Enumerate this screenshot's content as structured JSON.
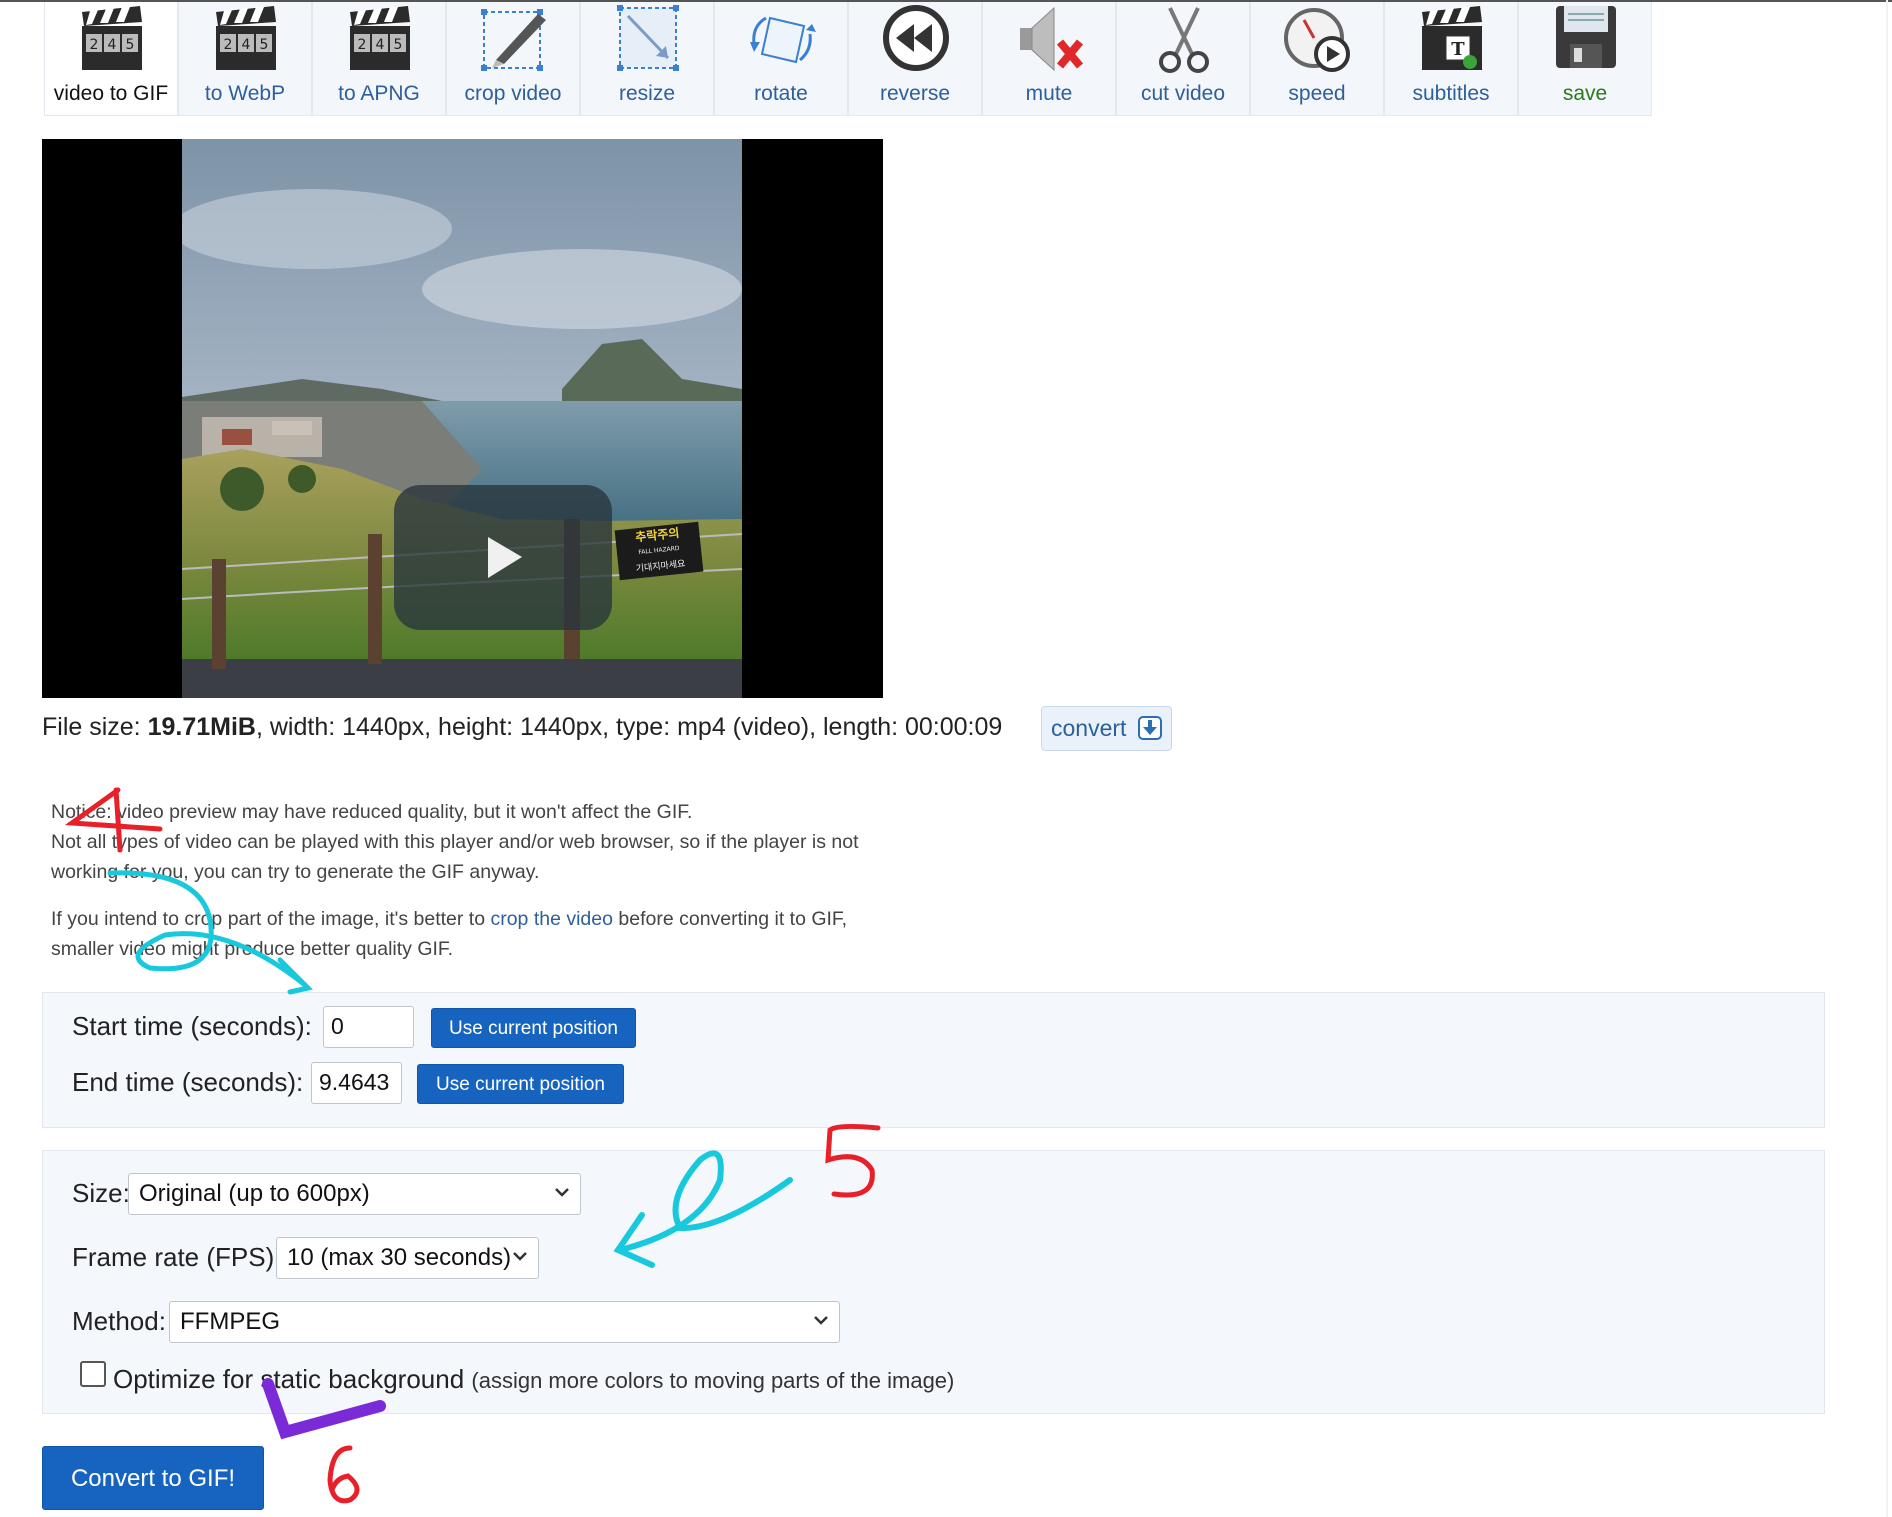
{
  "toolbar": {
    "tools": [
      {
        "label": "video to GIF",
        "icon": "clapperboard-icon"
      },
      {
        "label": "to WebP",
        "icon": "clapperboard-icon"
      },
      {
        "label": "to APNG",
        "icon": "clapperboard-icon"
      },
      {
        "label": "crop video",
        "icon": "crop-icon"
      },
      {
        "label": "resize",
        "icon": "resize-icon"
      },
      {
        "label": "rotate",
        "icon": "rotate-icon"
      },
      {
        "label": "reverse",
        "icon": "reverse-icon"
      },
      {
        "label": "mute",
        "icon": "mute-icon"
      },
      {
        "label": "cut video",
        "icon": "scissors-icon"
      },
      {
        "label": "speed",
        "icon": "speed-icon"
      },
      {
        "label": "subtitles",
        "icon": "subtitles-icon"
      },
      {
        "label": "save",
        "icon": "floppy-disk-icon"
      }
    ],
    "clapper_digits": [
      "2",
      "4",
      "5"
    ],
    "subtitle_glyph": "T"
  },
  "video": {
    "sign_title": "추락주의",
    "sign_sub": "FALL HAZARD",
    "sign_bottom": "기대지마세요"
  },
  "fileinfo": {
    "prefix": "File size: ",
    "size": "19.71MiB",
    "rest": ", width: 1440px, height: 1440px, type: mp4 (video), length: 00:00:09",
    "convert_label": "convert"
  },
  "notice": {
    "line1": "Notice: video preview may have reduced quality, but it won't affect the GIF.",
    "line2": "Not all types of video can be played with this player and/or web browser, so if the player is not",
    "line3": "working for you, you can try to generate the GIF anyway.",
    "crop_before": "If you intend to crop part of the image, it's better to ",
    "crop_link": "crop the video",
    "crop_after": " before converting it to GIF,",
    "crop_line2": "smaller video might produce better quality GIF."
  },
  "time": {
    "start_label": "Start time (seconds):",
    "start_value": "0",
    "end_label": "End time (seconds):",
    "end_value": "9.4643",
    "use_current": "Use current position"
  },
  "options": {
    "size_label": "Size:",
    "size_value": "Original (up to 600px)",
    "fps_label": "Frame rate (FPS):",
    "fps_value": "10 (max 30 seconds)",
    "method_label": "Method:",
    "method_value": "FFMPEG",
    "optimize_label": "Optimize for static background",
    "optimize_note": "(assign more colors to moving parts of the image)",
    "optimize_checked": false
  },
  "convert_gif_label": "Convert to GIF!",
  "annotations": {
    "four": "4",
    "five": "5",
    "six": "6"
  },
  "colors": {
    "link": "#2d5f9a",
    "button": "#1764c0",
    "save": "#2a7a1a",
    "anno_red": "#e8202a",
    "anno_cyan": "#18c9dd"
  }
}
